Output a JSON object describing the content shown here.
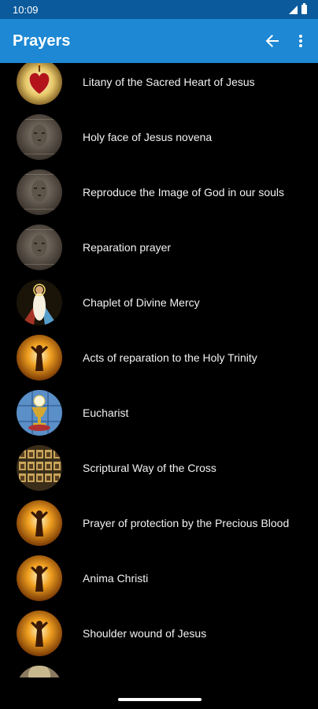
{
  "status_bar": {
    "time": "10:09"
  },
  "app_bar": {
    "title": "Prayers",
    "back_icon": "arrow-back-icon",
    "more_icon": "more-vert-icon"
  },
  "colors": {
    "status_bar": "#0a5a9c",
    "app_bar": "#1e88d4",
    "background": "#000000",
    "text": "#ffffff"
  },
  "prayers": [
    {
      "label": "Litany of the Sacred Heart of Jesus",
      "image": "sacred-heart"
    },
    {
      "label": "Holy face of Jesus novena",
      "image": "holy-face"
    },
    {
      "label": "Reproduce the Image of God in our souls",
      "image": "holy-face"
    },
    {
      "label": "Reparation prayer",
      "image": "holy-face"
    },
    {
      "label": "Chaplet of Divine Mercy",
      "image": "divine-mercy"
    },
    {
      "label": "Acts of reparation to the Holy Trinity",
      "image": "risen-christ"
    },
    {
      "label": "Eucharist",
      "image": "eucharist"
    },
    {
      "label": "Scriptural Way of the Cross",
      "image": "stations"
    },
    {
      "label": "Prayer of protection by the Precious Blood",
      "image": "risen-christ"
    },
    {
      "label": "Anima Christi",
      "image": "risen-christ"
    },
    {
      "label": "Shoulder wound of Jesus",
      "image": "risen-christ"
    }
  ]
}
